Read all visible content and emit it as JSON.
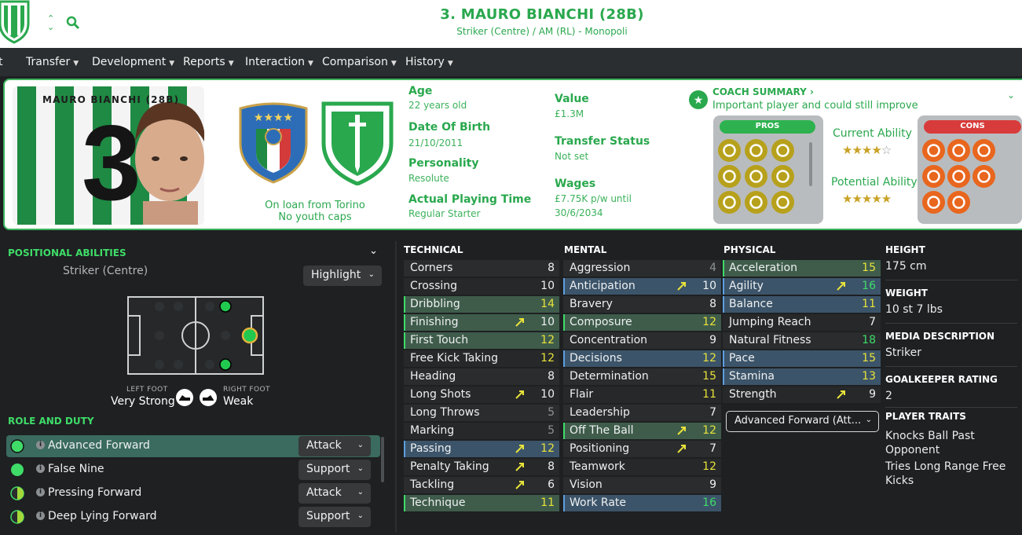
{
  "header": {
    "title": "3. MAURO BIANCHI (28B)",
    "subtitle": "Striker (Centre) / AM (RL) - Monopoli"
  },
  "nav": [
    "t",
    "Transfer",
    "Development",
    "Reports",
    "Interaction",
    "Comparison",
    "History"
  ],
  "card": {
    "shirt_name": "MAURO BIANCHI (28B)",
    "shirt_number": "3",
    "loan_text": "On loan from Torino",
    "caps_text": "No youth caps",
    "age_label": "Age",
    "age_value": "22 years old",
    "dob_label": "Date Of Birth",
    "dob_value": "21/10/2011",
    "personality_label": "Personality",
    "personality_value": "Resolute",
    "apt_label": "Actual Playing Time",
    "apt_value": "Regular Starter",
    "value_label": "Value",
    "value_value": "£1.3M",
    "transfer_label": "Transfer Status",
    "transfer_value": "Not set",
    "wages_label": "Wages",
    "wages_line1": "£7.75K p/w until",
    "wages_line2": "30/6/2034",
    "coach_label": "COACH SUMMARY",
    "coach_text": "Important player and could still improve",
    "pros_label": "PROS",
    "cons_label": "CONS",
    "ca_label": "Current Ability",
    "ca_stars": 3.5,
    "pa_label": "Potential Ability",
    "pa_stars": 5
  },
  "positional": {
    "title": "POSITIONAL ABILITIES",
    "position": "Striker (Centre)",
    "highlight_label": "Highlight",
    "left_foot_label": "LEFT FOOT",
    "left_foot_value": "Very Strong",
    "right_foot_label": "RIGHT FOOT",
    "right_foot_value": "Weak"
  },
  "roles": {
    "title": "ROLE AND DUTY",
    "items": [
      {
        "name": "Advanced Forward",
        "duty": "Attack"
      },
      {
        "name": "False Nine",
        "duty": "Support"
      },
      {
        "name": "Pressing Forward",
        "duty": "Attack"
      },
      {
        "name": "Deep Lying Forward",
        "duty": "Support"
      }
    ]
  },
  "technical": {
    "title": "TECHNICAL",
    "rows": [
      {
        "name": "Corners",
        "value": "8"
      },
      {
        "name": "Crossing",
        "value": "10"
      },
      {
        "name": "Dribbling",
        "value": "14"
      },
      {
        "name": "Finishing",
        "value": "10"
      },
      {
        "name": "First Touch",
        "value": "12"
      },
      {
        "name": "Free Kick Taking",
        "value": "12"
      },
      {
        "name": "Heading",
        "value": "8"
      },
      {
        "name": "Long Shots",
        "value": "10"
      },
      {
        "name": "Long Throws",
        "value": "5"
      },
      {
        "name": "Marking",
        "value": "5"
      },
      {
        "name": "Passing",
        "value": "12"
      },
      {
        "name": "Penalty Taking",
        "value": "8"
      },
      {
        "name": "Tackling",
        "value": "6"
      },
      {
        "name": "Technique",
        "value": "11"
      }
    ]
  },
  "mental": {
    "title": "MENTAL",
    "rows": [
      {
        "name": "Aggression",
        "value": "4"
      },
      {
        "name": "Anticipation",
        "value": "10"
      },
      {
        "name": "Bravery",
        "value": "8"
      },
      {
        "name": "Composure",
        "value": "12"
      },
      {
        "name": "Concentration",
        "value": "9"
      },
      {
        "name": "Decisions",
        "value": "12"
      },
      {
        "name": "Determination",
        "value": "15"
      },
      {
        "name": "Flair",
        "value": "11"
      },
      {
        "name": "Leadership",
        "value": "7"
      },
      {
        "name": "Off The Ball",
        "value": "12"
      },
      {
        "name": "Positioning",
        "value": "7"
      },
      {
        "name": "Teamwork",
        "value": "12"
      },
      {
        "name": "Vision",
        "value": "9"
      },
      {
        "name": "Work Rate",
        "value": "16"
      }
    ]
  },
  "physical": {
    "title": "PHYSICAL",
    "rows": [
      {
        "name": "Acceleration",
        "value": "15"
      },
      {
        "name": "Agility",
        "value": "16"
      },
      {
        "name": "Balance",
        "value": "11"
      },
      {
        "name": "Jumping Reach",
        "value": "7"
      },
      {
        "name": "Natural Fitness",
        "value": "18"
      },
      {
        "name": "Pace",
        "value": "15"
      },
      {
        "name": "Stamina",
        "value": "13"
      },
      {
        "name": "Strength",
        "value": "9"
      }
    ],
    "role_dropdown": "Advanced Forward (Att..."
  },
  "info": {
    "height_label": "HEIGHT",
    "height_value": "175 cm",
    "weight_label": "WEIGHT",
    "weight_value": "10 st 7 lbs",
    "media_label": "MEDIA DESCRIPTION",
    "media_value": "Striker",
    "gk_label": "GOALKEEPER RATING",
    "gk_value": "2",
    "traits_label": "PLAYER TRAITS",
    "trait1_l1": "Knocks Ball Past",
    "trait1_l2": "Opponent",
    "trait2_l1": "Tries Long Range Free",
    "trait2_l2": "Kicks"
  },
  "colors": {
    "accent": "#2aa84e",
    "highlight_green": "#3fdc68",
    "highlight_yellow": "#e8e33a",
    "panel_bg": "#1e2022"
  },
  "icons": {
    "pros": [
      "star-icon",
      "trend-icon",
      "handshake-icon",
      "boot-icon",
      "cones-icon",
      "target-icon",
      "clipboard-icon",
      "wave-icon",
      "pitch-icon"
    ],
    "cons": [
      "target-icon",
      "medical-cross-icon",
      "scissors-icon",
      "spring-icon",
      "flask-icon",
      "tag-icon",
      "car-icon",
      "phone-icon"
    ]
  }
}
